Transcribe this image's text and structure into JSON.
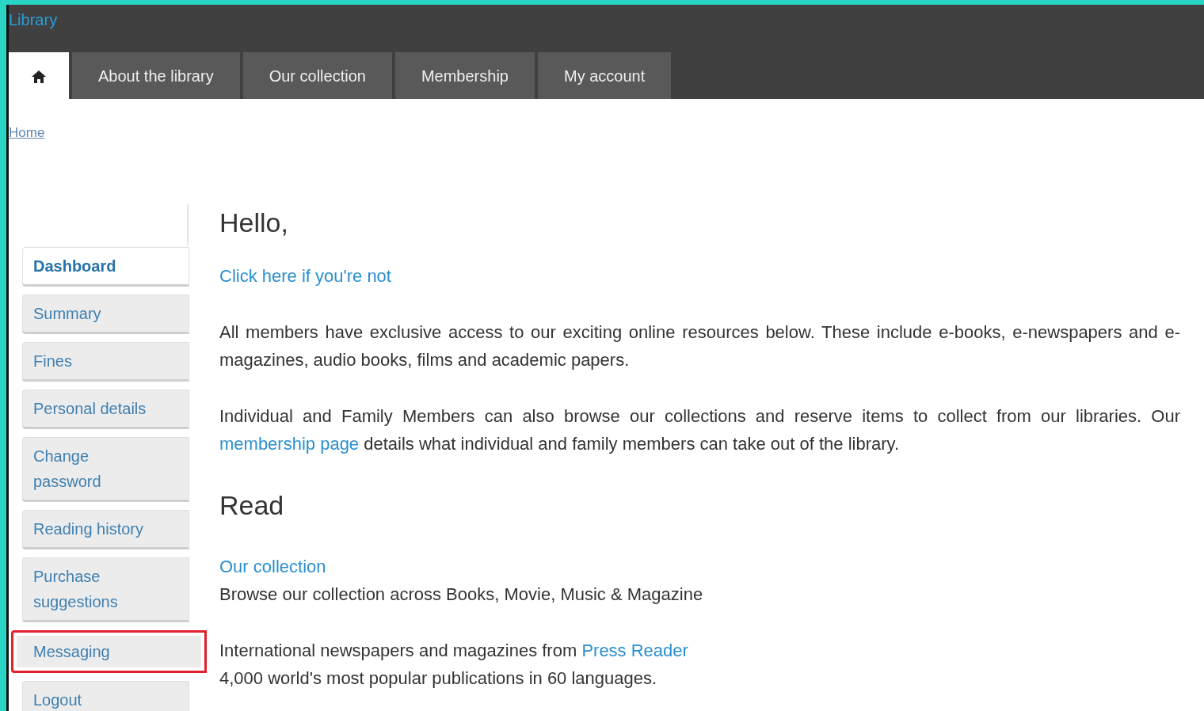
{
  "site_title": "Library",
  "nav_tabs": [
    {
      "kind": "home",
      "selected": true
    },
    {
      "kind": "text",
      "label": "About the library",
      "selected": false
    },
    {
      "kind": "text",
      "label": "Our collection",
      "selected": false
    },
    {
      "kind": "text",
      "label": "Membership",
      "selected": false
    },
    {
      "kind": "text",
      "label": "My account",
      "selected": false
    }
  ],
  "breadcrumb": [
    "Home"
  ],
  "sidebar": {
    "items": [
      {
        "label": "Dashboard",
        "selected": true,
        "highlighted": false
      },
      {
        "label": "Summary",
        "selected": false,
        "highlighted": false
      },
      {
        "label": "Fines",
        "selected": false,
        "highlighted": false
      },
      {
        "label": "Personal details",
        "selected": false,
        "highlighted": false
      },
      {
        "label": "Change password",
        "selected": false,
        "highlighted": false
      },
      {
        "label": "Reading history",
        "selected": false,
        "highlighted": false
      },
      {
        "label": "Purchase suggestions",
        "selected": false,
        "highlighted": false
      },
      {
        "label": "Messaging",
        "selected": false,
        "highlighted": true
      },
      {
        "label": "Logout",
        "selected": false,
        "highlighted": false
      }
    ]
  },
  "content": {
    "greeting": "Hello,",
    "not_you_link": "Click here if you're not",
    "paragraphs": [
      [
        {
          "kind": "text",
          "text": "All members have exclusive access to our exciting online resources below. These include e-books, e-newspapers and e-magazines, audio books, films and academic papers."
        }
      ],
      [
        {
          "kind": "text",
          "text": "Individual and Family Members can also browse our collections and reserve items to collect from our libraries. Our "
        },
        {
          "kind": "link",
          "text": "membership page"
        },
        {
          "kind": "text",
          "text": " details what individual and family members can take out of the library."
        }
      ]
    ],
    "section_heading": "Read",
    "resources": [
      {
        "lines": [
          [
            {
              "kind": "link",
              "text": "Our collection"
            }
          ],
          [
            {
              "kind": "text",
              "text": "Browse our collection across Books, Movie, Music & Magazine"
            }
          ]
        ]
      },
      {
        "lines": [
          [
            {
              "kind": "text",
              "text": "International newspapers and magazines from "
            },
            {
              "kind": "link",
              "text": "Press Reader"
            }
          ],
          [
            {
              "kind": "text",
              "text": "4,000 world's most popular publications in 60 languages."
            }
          ]
        ]
      }
    ]
  }
}
